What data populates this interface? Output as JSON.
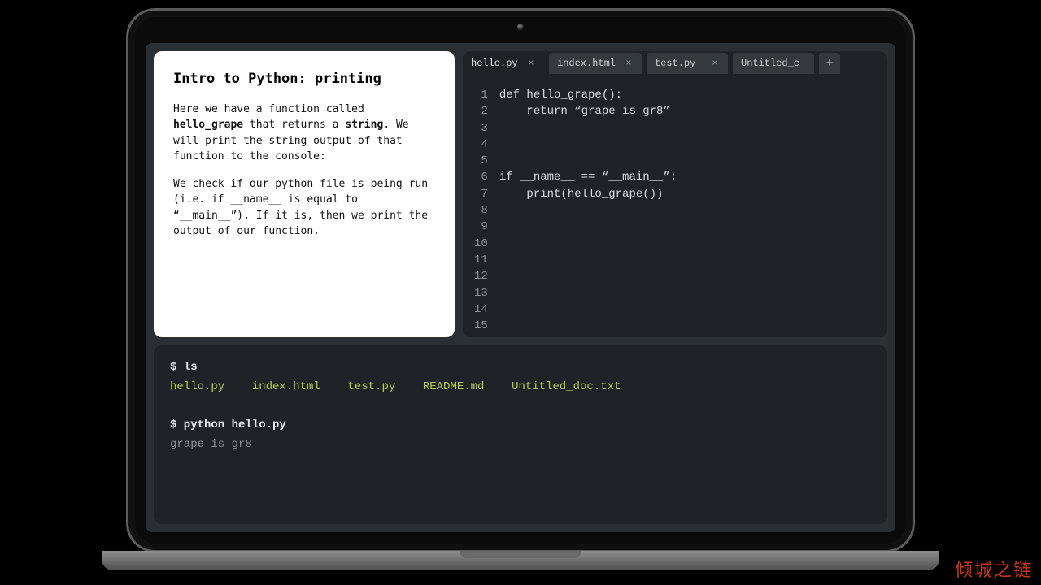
{
  "lesson": {
    "title": "Intro to Python: printing",
    "p1_a": "Here we have a function called ",
    "p1_b": "hello_grape",
    "p1_c": " that returns a ",
    "p1_d": "string",
    "p1_e": ". We will print the string output of that function to the console:",
    "p2": "We check if our python file is being run (i.e. if __name__ is equal to “__main__”). If it is, then we print the output of our function."
  },
  "editor": {
    "tabs": [
      {
        "label": "hello.py",
        "active": true
      },
      {
        "label": "index.html",
        "active": false
      },
      {
        "label": "test.py",
        "active": false
      },
      {
        "label": "Untitled_c",
        "active": false
      }
    ],
    "add_label": "+",
    "line_count": 16,
    "code": "def hello_grape():\n    return “grape is gr8”\n\n\n\nif __name__ == “__main__”:\n    print(hello_grape())\n\n\n\n\n\n\n\n\n"
  },
  "terminal": {
    "prompt1": "$ ls",
    "files": [
      "hello.py",
      "index.html",
      "test.py",
      "README.md",
      "Untitled_doc.txt"
    ],
    "prompt2": "$ python hello.py",
    "output": "grape is gr8"
  },
  "watermark": "倾城之链"
}
